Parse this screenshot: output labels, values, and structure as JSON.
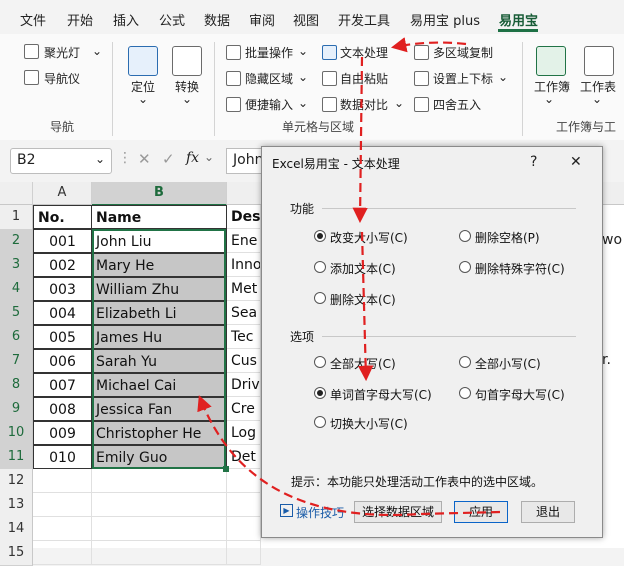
{
  "menu": [
    "文件",
    "开始",
    "插入",
    "公式",
    "数据",
    "审阅",
    "视图",
    "开发工具",
    "易用宝 plus",
    "易用宝"
  ],
  "ribbon": {
    "nav_group": {
      "items": [
        "聚光灯",
        "导航仪"
      ],
      "label": "导航"
    },
    "big_buttons": [
      "定位",
      "转换"
    ],
    "cells_group": {
      "col1": [
        "批量操作",
        "隐藏区域",
        "便捷输入"
      ],
      "col2": [
        "文本处理",
        "自由粘贴",
        "数据对比"
      ],
      "col3": [
        "多区域复制",
        "设置上下标",
        "四舍五入"
      ],
      "label": "单元格与区域"
    },
    "workbook_group": {
      "items": [
        "工作簿",
        "工作表"
      ],
      "label": "工作簿与工"
    }
  },
  "formula_bar": {
    "name_box": "B2",
    "cancel": "✕",
    "confirm": "✓",
    "fx": "fx",
    "content": "John"
  },
  "sheet": {
    "columns": [
      "A",
      "B"
    ],
    "col_c_partial": "Desc",
    "rows": [
      "1",
      "2",
      "3",
      "4",
      "5",
      "6",
      "7",
      "8",
      "9",
      "10",
      "11",
      "12",
      "13",
      "14",
      "15"
    ],
    "header": {
      "no": "No.",
      "name": "Name"
    },
    "data": [
      {
        "no": "001",
        "name": "John Liu",
        "c": "Ene"
      },
      {
        "no": "002",
        "name": "Mary He",
        "c": "Inno"
      },
      {
        "no": "003",
        "name": "William Zhu",
        "c": "Met"
      },
      {
        "no": "004",
        "name": "Elizabeth Li",
        "c": "Sea"
      },
      {
        "no": "005",
        "name": "James Hu",
        "c": "Tec"
      },
      {
        "no": "006",
        "name": "Sarah Yu",
        "c": "Cus"
      },
      {
        "no": "007",
        "name": "Michael Cai",
        "c": "Driv"
      },
      {
        "no": "008",
        "name": "Jessica Fan",
        "c": "Cre"
      },
      {
        "no": "009",
        "name": "Christopher He",
        "c": "Log"
      },
      {
        "no": "010",
        "name": "Emily Guo",
        "c": "Det"
      }
    ],
    "right_partial": {
      "row2": "wo",
      "row7": "r."
    }
  },
  "dialog": {
    "title": "Excel易用宝 - 文本处理",
    "help": "?",
    "close": "✕",
    "function_label": "功能",
    "function_options": [
      "改变大小写(C)",
      "删除空格(P)",
      "添加文本(C)",
      "删除特殊字符(C)",
      "删除文本(C)"
    ],
    "options_label": "选项",
    "case_options": [
      "全部大写(C)",
      "全部小写(C)",
      "单词首字母大写(C)",
      "句首字母大写(C)",
      "切换大小写(C)"
    ],
    "hint": "提示：本功能只处理活动工作表中的选中区域。",
    "help_link": "操作技巧",
    "select_button": "选择数据区域",
    "apply_button": "应用",
    "exit_button": "退出"
  },
  "colors": {
    "excel_green": "#217346",
    "selection_gray": "#c6c6c6",
    "arrow_red": "#e02020"
  }
}
